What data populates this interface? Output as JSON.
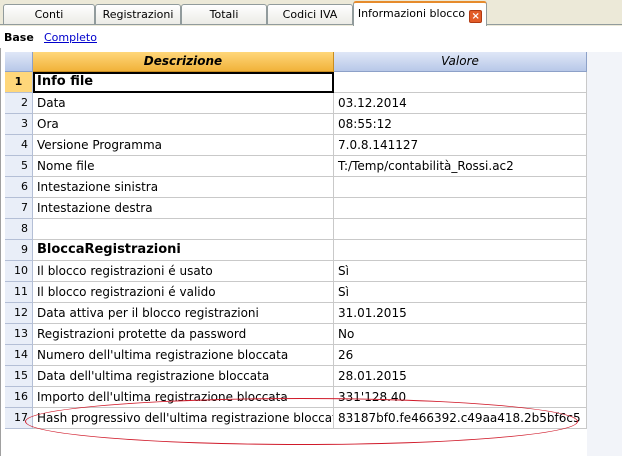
{
  "tabs": [
    {
      "label": "Conti",
      "active": false
    },
    {
      "label": "Registrazioni",
      "active": false
    },
    {
      "label": "Totali",
      "active": false
    },
    {
      "label": "Codici IVA",
      "active": false
    },
    {
      "label": "Informazioni blocco",
      "active": true
    }
  ],
  "views": {
    "base": "Base",
    "completo": "Completo"
  },
  "columns": {
    "description": "Descrizione",
    "value": "Valore"
  },
  "rows": [
    {
      "n": "1",
      "description": "Info file",
      "value": "",
      "bold": true
    },
    {
      "n": "2",
      "description": "Data",
      "value": "03.12.2014"
    },
    {
      "n": "3",
      "description": "Ora",
      "value": "08:55:12"
    },
    {
      "n": "4",
      "description": "Versione Programma",
      "value": "7.0.8.141127"
    },
    {
      "n": "5",
      "description": "Nome file",
      "value": "T:/Temp/contabilità_Rossi.ac2"
    },
    {
      "n": "6",
      "description": "Intestazione sinistra",
      "value": ""
    },
    {
      "n": "7",
      "description": "Intestazione destra",
      "value": ""
    },
    {
      "n": "8",
      "description": "",
      "value": ""
    },
    {
      "n": "9",
      "description": "BloccaRegistrazioni",
      "value": "",
      "bold": true
    },
    {
      "n": "10",
      "description": "Il blocco registrazioni é usato",
      "value": "Sì"
    },
    {
      "n": "11",
      "description": "Il blocco registrazioni é valido",
      "value": "Sì"
    },
    {
      "n": "12",
      "description": "Data attiva per il blocco registrazioni",
      "value": "31.01.2015"
    },
    {
      "n": "13",
      "description": "Registrazioni protette da password",
      "value": "No"
    },
    {
      "n": "14",
      "description": "Numero dell'ultima registrazione bloccata",
      "value": "26"
    },
    {
      "n": "15",
      "description": "Data dell'ultima registrazione bloccata",
      "value": "28.01.2015"
    },
    {
      "n": "16",
      "description": "Importo dell'ultima registrazione bloccata",
      "value": "331'128.40"
    },
    {
      "n": "17",
      "description": "Hash progressivo dell'ultima registrazione bloccata",
      "value": "83187bf0.fe466392.c49aa418.2b5bf6c5"
    }
  ],
  "colors": {
    "accent": "#f1b23a",
    "highlight_oval": "#d01a2a",
    "tab_active_border": "#e68b2c"
  }
}
